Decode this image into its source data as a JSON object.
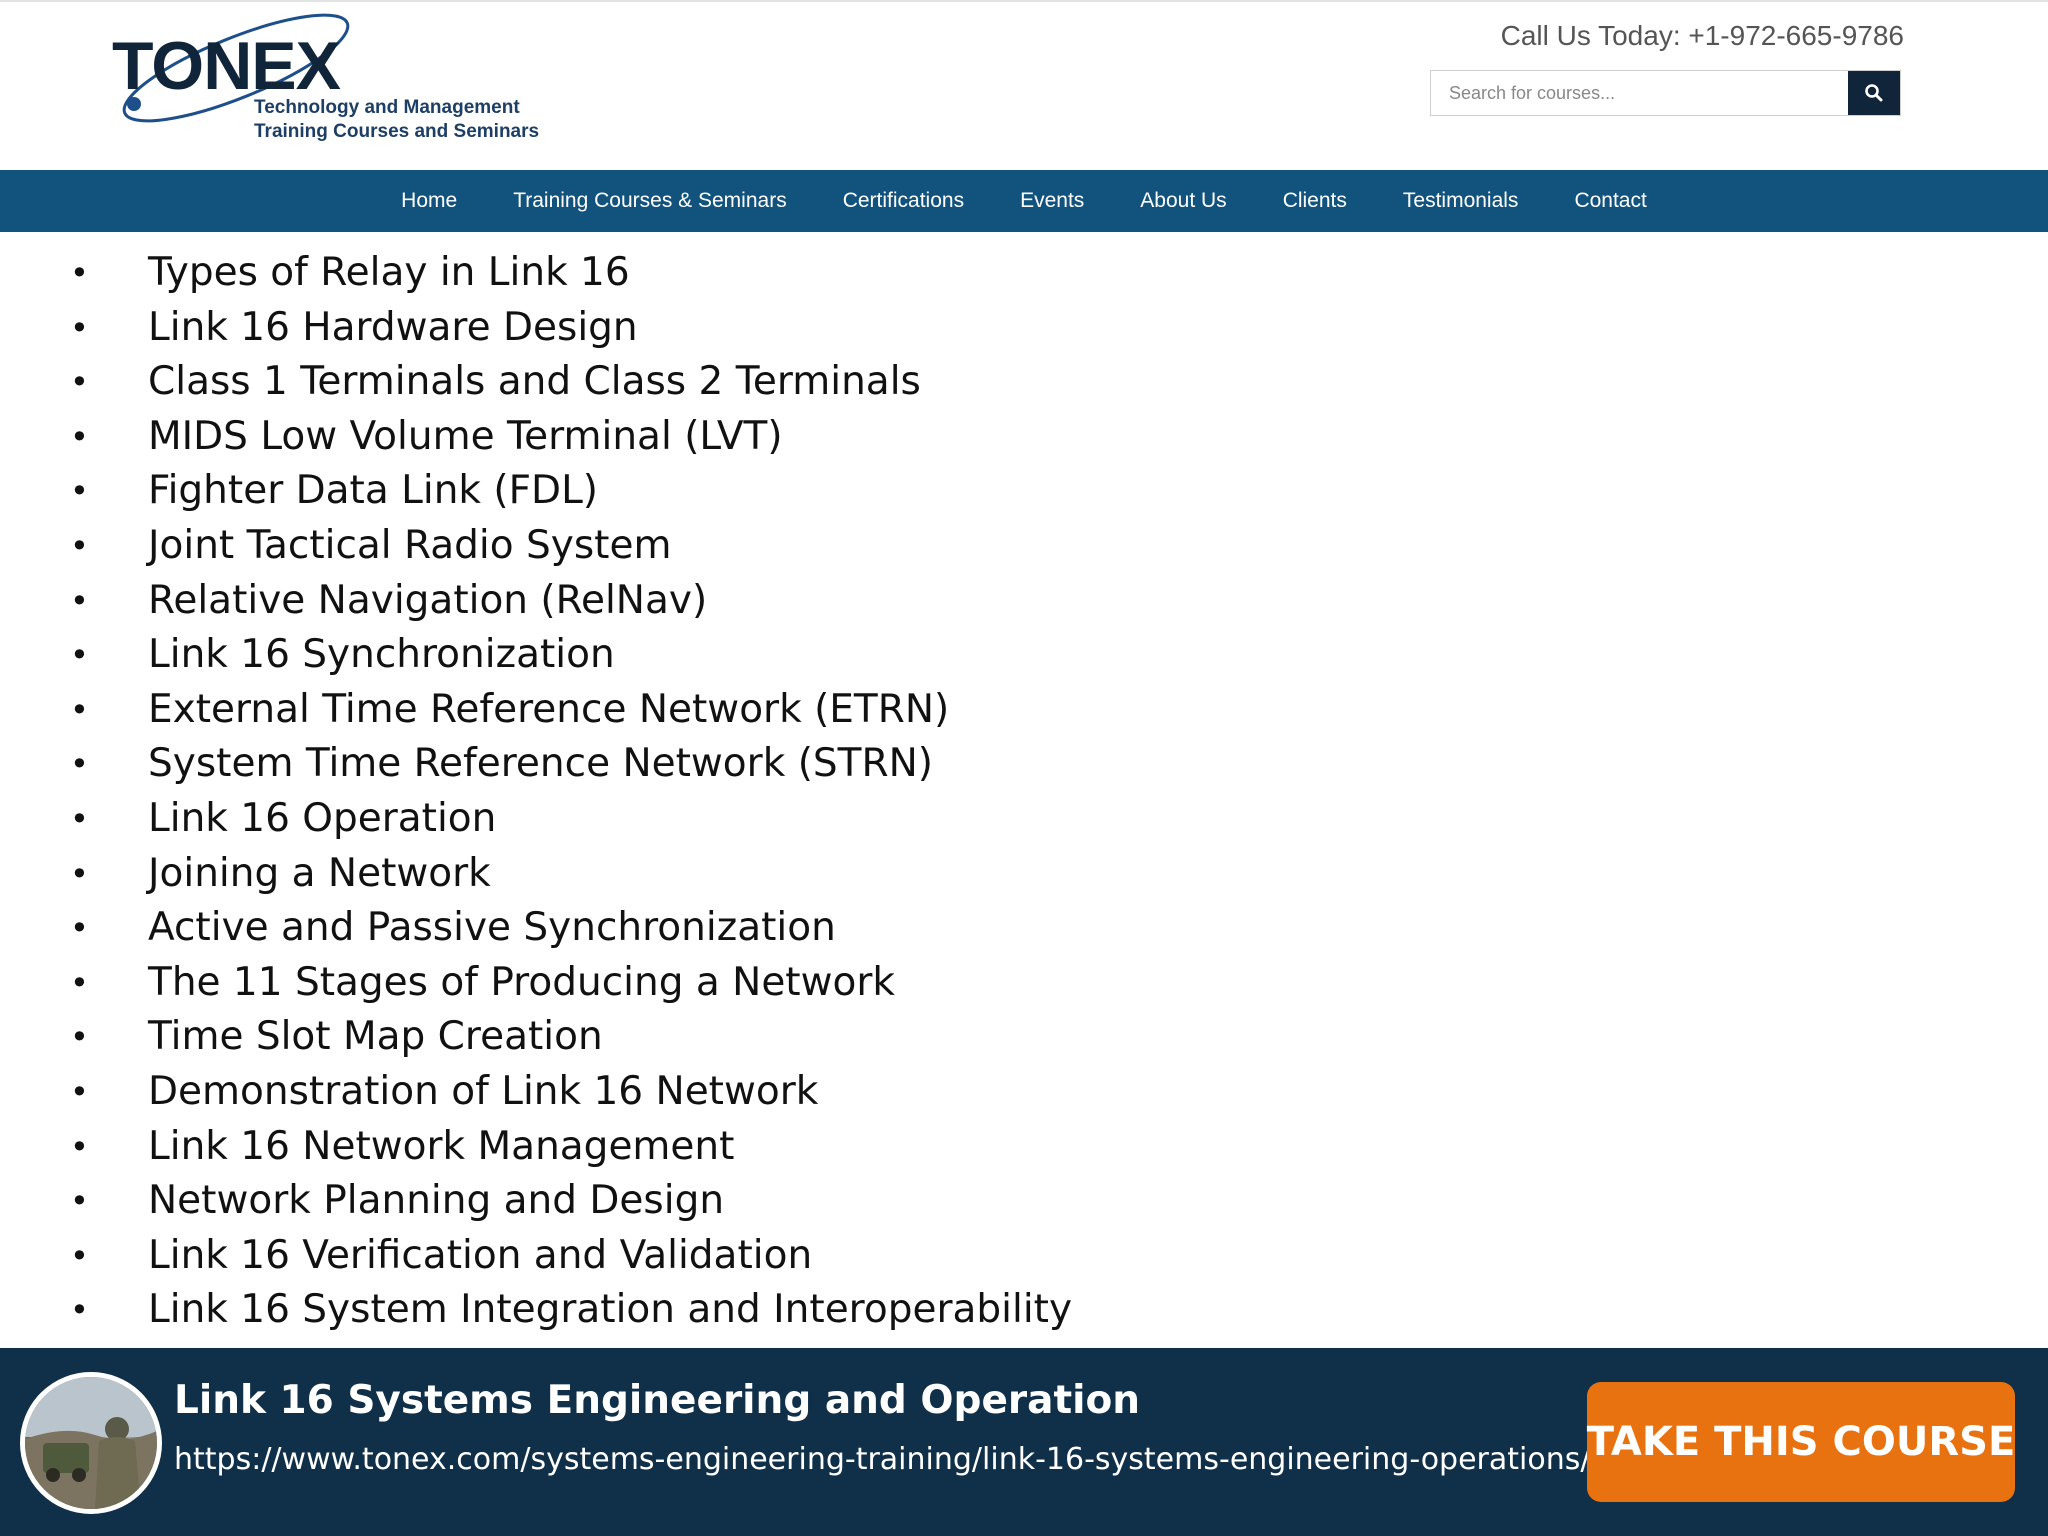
{
  "header": {
    "logo": {
      "name": "TONEX",
      "tagline_line1": "Technology and Management",
      "tagline_line2": "Training Courses and Seminars"
    },
    "call_text": "Call Us Today: +1-972-665-9786",
    "search": {
      "placeholder": "Search for courses...",
      "icon": "search-icon"
    }
  },
  "nav": {
    "items": [
      {
        "label": "Home"
      },
      {
        "label": "Training Courses & Seminars"
      },
      {
        "label": "Certifications"
      },
      {
        "label": "Events"
      },
      {
        "label": "About Us"
      },
      {
        "label": "Clients"
      },
      {
        "label": "Testimonials"
      },
      {
        "label": "Contact"
      }
    ]
  },
  "content": {
    "bullet": "•",
    "topics": [
      "Types of Relay in Link 16",
      "Link 16 Hardware Design",
      "Class 1 Terminals and Class 2 Terminals",
      "MIDS Low Volume Terminal (LVT)",
      "Fighter Data Link (FDL)",
      "Joint Tactical Radio System",
      "Relative Navigation (RelNav)",
      "Link 16 Synchronization",
      "External Time Reference Network (ETRN)",
      "System Time Reference Network (STRN)",
      "Link 16 Operation",
      "Joining a Network",
      "Active and Passive Synchronization",
      "The 11 Stages of Producing a Network",
      "Time Slot Map Creation",
      "Demonstration of Link 16 Network",
      "Link 16 Network Management",
      "Network Planning and Design",
      "Link 16 Verification and Validation",
      "Link 16 System Integration and Interoperability"
    ]
  },
  "banner": {
    "title": "Link 16 Systems Engineering and Operation",
    "url": "https://www.tonex.com/systems-engineering-training/link-16-systems-engineering-operations/",
    "cta_label": "TAKE THIS COURSE"
  },
  "colors": {
    "nav_bg": "#11537c",
    "banner_bg": "#10304a",
    "cta_bg": "#e8720f",
    "logo_text": "#10243a"
  }
}
